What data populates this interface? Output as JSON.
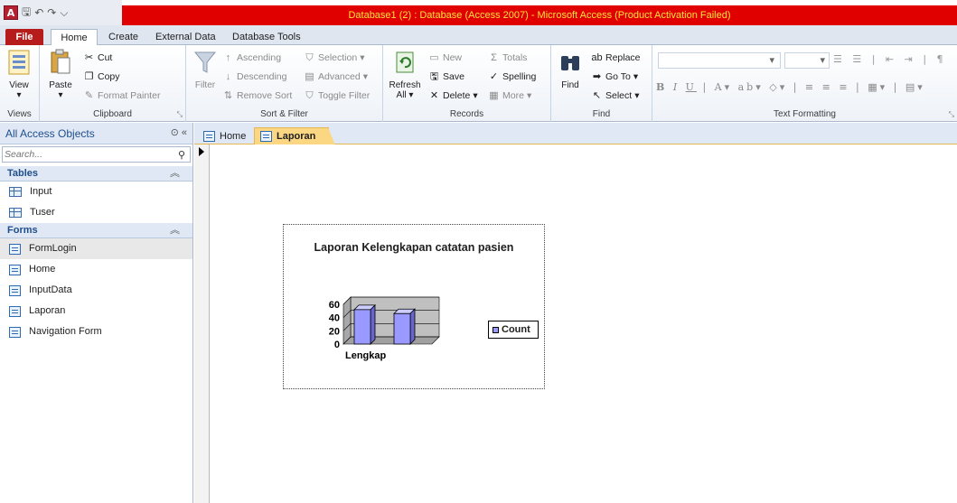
{
  "window": {
    "title": "Database1 (2) : Database (Access 2007)  -  Microsoft Access (Product Activation Failed)",
    "app_icon": "A"
  },
  "ribbon_tabs": [
    "File",
    "Home",
    "Create",
    "External Data",
    "Database Tools"
  ],
  "ribbon": {
    "views": {
      "label": "Views",
      "view": "View"
    },
    "clipboard": {
      "label": "Clipboard",
      "paste": "Paste",
      "cut": "Cut",
      "copy": "Copy",
      "format_painter": "Format Painter"
    },
    "sort_filter": {
      "label": "Sort & Filter",
      "filter": "Filter",
      "ascending": "Ascending",
      "descending": "Descending",
      "remove_sort": "Remove Sort",
      "selection": "Selection",
      "advanced": "Advanced",
      "toggle_filter": "Toggle Filter"
    },
    "records": {
      "label": "Records",
      "refresh": "Refresh",
      "refresh_all": "All",
      "new": "New",
      "save": "Save",
      "delete": "Delete",
      "totals": "Totals",
      "spelling": "Spelling",
      "more": "More"
    },
    "find": {
      "label": "Find",
      "find": "Find",
      "replace": "Replace",
      "goto": "Go To",
      "select": "Select"
    },
    "text_formatting": {
      "label": "Text Formatting"
    }
  },
  "nav_pane": {
    "header": "All Access Objects",
    "search_placeholder": "Search...",
    "groups": [
      {
        "name": "Tables",
        "items": [
          "Input",
          "Tuser"
        ]
      },
      {
        "name": "Forms",
        "items": [
          "FormLogin",
          "Home",
          "InputData",
          "Laporan",
          "Navigation Form"
        ]
      }
    ]
  },
  "document_tabs": [
    "Home",
    "Laporan"
  ],
  "chart_data": {
    "type": "bar",
    "title": "Laporan Kelengkapan catatan pasien",
    "categories": [
      "Lengkap"
    ],
    "series": [
      {
        "name": "Count",
        "values": [
          52,
          46
        ]
      }
    ],
    "ylim": [
      0,
      60
    ],
    "yticks": [
      0,
      20,
      40,
      60
    ],
    "legend": "right",
    "colors": {
      "bar": "#9999ff",
      "wall": "#c0c0c0"
    }
  }
}
